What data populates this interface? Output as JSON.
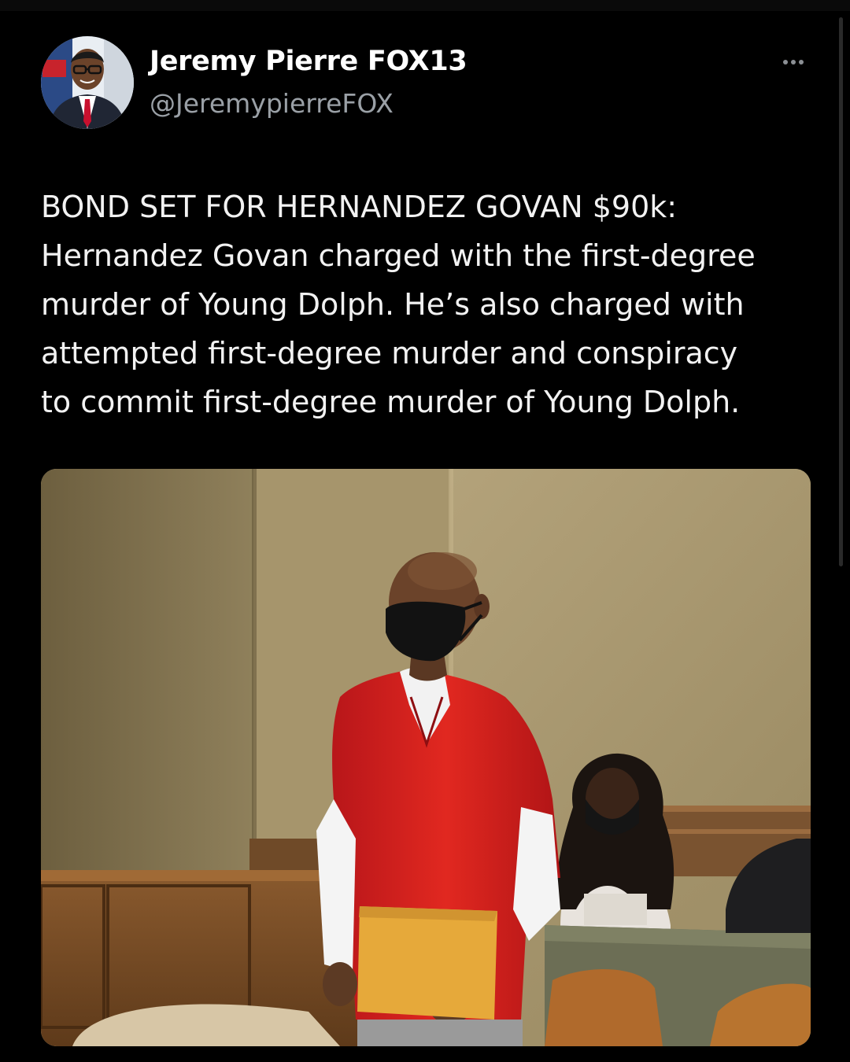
{
  "author": {
    "display_name": "Jeremy Pierre FOX13",
    "handle": "@JeremypierreFOX",
    "avatar_icon": "profile-photo"
  },
  "more_icon": "more-options-icon",
  "tweet": {
    "text": "BOND SET FOR HERNANDEZ GOVAN $90k:\nHernandez Govan charged with the first-degree\nmurder of Young Dolph. He’s also charged with\nattempted first-degree murder and conspiracy\nto commit first-degree murder of Young Dolph."
  },
  "media": {
    "type": "photo"
  },
  "colors": {
    "background": "#000000",
    "text": "#f2f2f2",
    "secondary_text": "#9aa0a6",
    "scrubs": "#d8231e",
    "envelope": "#e6a93a"
  }
}
